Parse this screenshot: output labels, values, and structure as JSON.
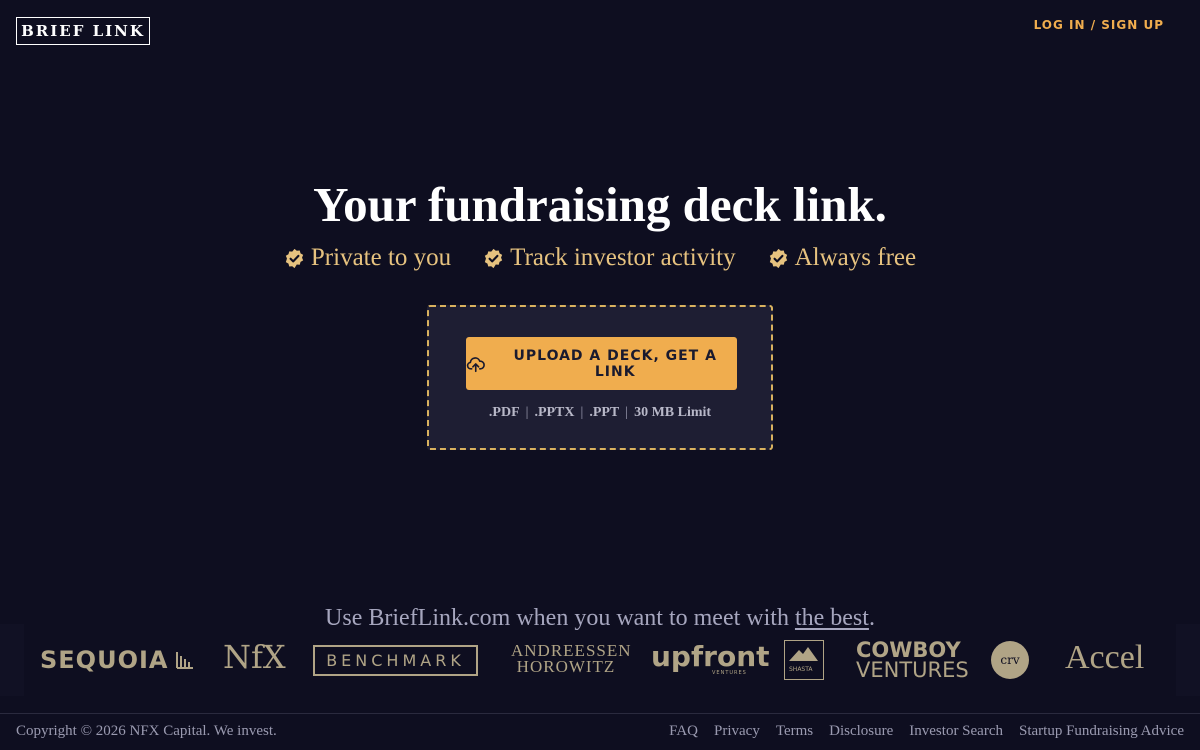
{
  "brand": {
    "logo_text": "BRIEF LINK"
  },
  "header": {
    "login_label": "LOG IN / SIGN UP"
  },
  "hero": {
    "headline": "Your fundraising deck link.",
    "features": [
      {
        "label": "Private to you",
        "icon": "verified-badge-icon"
      },
      {
        "label": "Track investor activity",
        "icon": "verified-badge-icon"
      },
      {
        "label": "Always free",
        "icon": "verified-badge-icon"
      }
    ]
  },
  "upload": {
    "button_label": "UPLOAD A DECK, GET A LINK",
    "button_icon": "cloud-upload-icon",
    "formats": [
      ".PDF",
      ".PPTX",
      ".PPT",
      "30 MB Limit"
    ]
  },
  "tagline": {
    "prefix": "Use BriefLink.com when you want to meet with ",
    "link": "the best",
    "suffix": "."
  },
  "investors": {
    "sequoia": "SEQUOIA",
    "nfx": "NfX",
    "benchmark": "BENCHMARK",
    "a16z_line1": "ANDREESSEN",
    "a16z_line2": "HOROWITZ",
    "upfront": "upfront",
    "upfront_sub": "VENTURES",
    "shasta": "SHASTA",
    "cowboy_line1": "COWBOY",
    "cowboy_line2": "VENTURES",
    "crv": "crv",
    "accel": "Accel"
  },
  "footer": {
    "copyright": "Copyright © 2026 NFX Capital. We invest.",
    "links": [
      "FAQ",
      "Privacy",
      "Terms",
      "Disclosure",
      "Investor Search",
      "Startup Fundraising Advice"
    ]
  },
  "colors": {
    "background": "#0e0e20",
    "accent": "#f0ad4e",
    "gold_text": "#e6c27f",
    "dropzone_bg": "#1e1e33"
  }
}
